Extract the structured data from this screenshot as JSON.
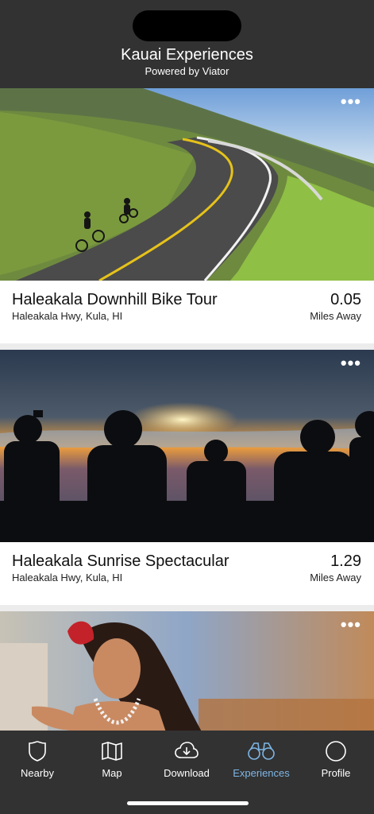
{
  "header": {
    "title": "Kauai Experiences",
    "subtitle": "Powered by Viator"
  },
  "more_label": "•••",
  "experiences": [
    {
      "name": "Haleakala Downhill Bike Tour",
      "address": "Haleakala Hwy, Kula, HI",
      "distance": "0.05",
      "distance_unit": "Miles Away"
    },
    {
      "name": "Haleakala Sunrise Spectacular",
      "address": "Haleakala Hwy, Kula, HI",
      "distance": "1.29",
      "distance_unit": "Miles Away"
    }
  ],
  "tabs": [
    {
      "label": "Nearby",
      "icon": "shield-icon",
      "active": false
    },
    {
      "label": "Map",
      "icon": "map-icon",
      "active": false
    },
    {
      "label": "Download",
      "icon": "cloud-download-icon",
      "active": false
    },
    {
      "label": "Experiences",
      "icon": "binoculars-icon",
      "active": true
    },
    {
      "label": "Profile",
      "icon": "profile-circle-icon",
      "active": false
    }
  ],
  "colors": {
    "bar_bg": "#323232",
    "active_tab": "#7eb6e6",
    "text": "#111111"
  }
}
